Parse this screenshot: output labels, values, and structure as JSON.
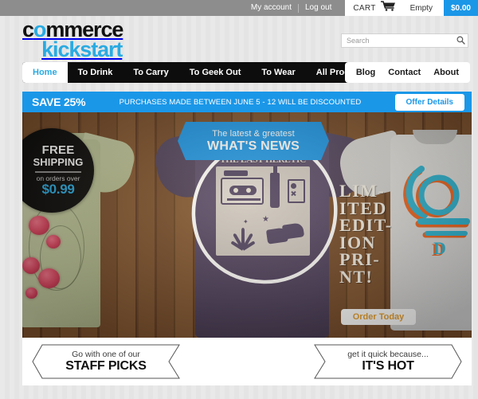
{
  "topbar": {
    "my_account": "My account",
    "log_out": "Log out",
    "cart_label": "CART",
    "cart_icon": "shopping-cart-icon",
    "cart_status": "Empty",
    "cart_total": "$0.00",
    "total_bg": "#1b97e8"
  },
  "header": {
    "logo_line1_pre": "c",
    "logo_line1_accent": "o",
    "logo_line1_post": "mmerce",
    "logo_line2": "kickstart",
    "logo_accent_color": "#29abe2",
    "search_placeholder": "Search",
    "search_value": "",
    "search_icon": "search-icon"
  },
  "nav": {
    "main": [
      {
        "label": "Home",
        "active": true
      },
      {
        "label": "To Drink",
        "active": false
      },
      {
        "label": "To Carry",
        "active": false
      },
      {
        "label": "To Geek Out",
        "active": false
      },
      {
        "label": "To Wear",
        "active": false
      },
      {
        "label": "All Products",
        "active": false
      }
    ],
    "secondary": [
      {
        "label": "Blog"
      },
      {
        "label": "Contact"
      },
      {
        "label": "About"
      }
    ]
  },
  "promo": {
    "save": "SAVE 25%",
    "message": "PURCHASES MADE BETWEEN JUNE 5 - 12 WILL BE DISCOUNTED",
    "button": "Offer Details",
    "bg_color": "#1b97e8"
  },
  "hero": {
    "shipping_badge": {
      "line1": "FREE",
      "line2": "SHIPPING",
      "line3": "on orders over",
      "price": "$0.99",
      "price_color": "#29abe2"
    },
    "news_badge": {
      "small": "The latest & greatest",
      "big": "WHAT'S NEWS",
      "bg_color": "#1b97e8"
    },
    "shirt_print_title": "THE LAST HERETIC",
    "limited_lines": [
      "LIM-",
      "ITED",
      "EDIT-",
      "ION",
      "PRI-",
      "NT!"
    ],
    "order_button": "Order Today",
    "order_button_color": "#e8a02c"
  },
  "bottom": {
    "left": {
      "sub": "Go with one of our",
      "main": "STAFF PICKS"
    },
    "right": {
      "sub": "get it quick because...",
      "main": "IT'S HOT"
    }
  }
}
